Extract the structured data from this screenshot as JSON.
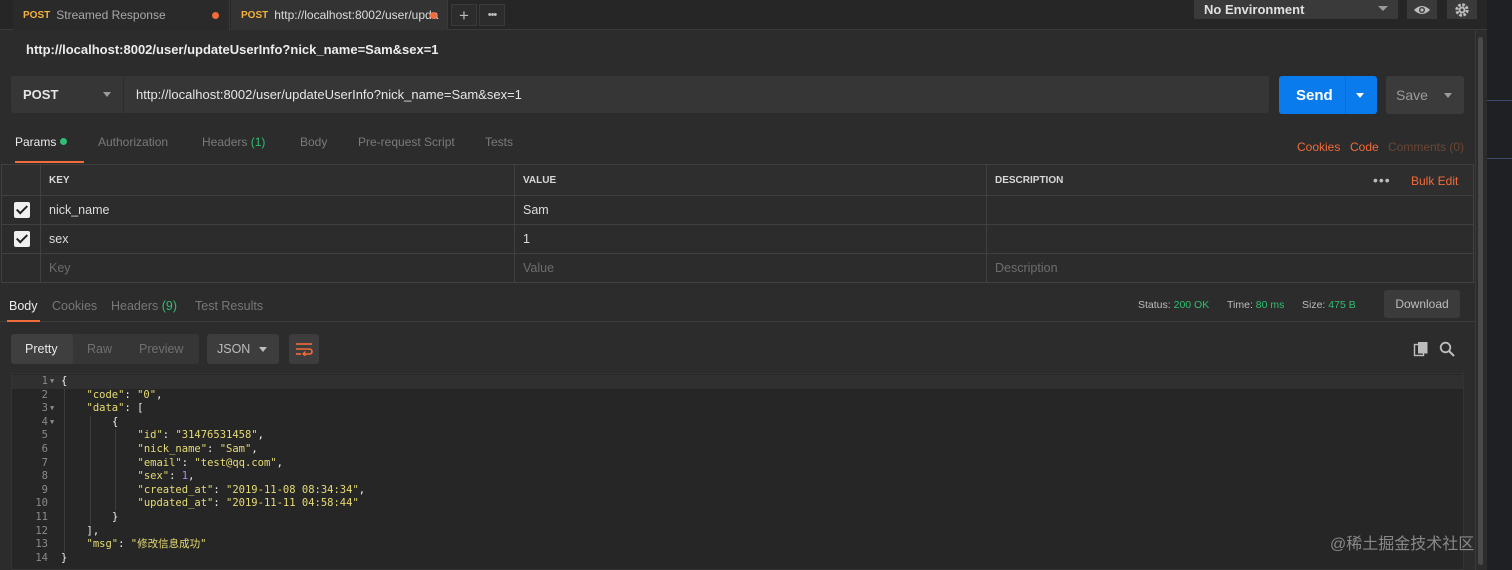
{
  "tabs": [
    {
      "method": "POST",
      "title": "Streamed Response"
    },
    {
      "method": "POST",
      "title": "http://localhost:8002/user/upda"
    }
  ],
  "tab_actions": {
    "add": "+",
    "more": "•••"
  },
  "environment": {
    "selected": "No Environment"
  },
  "request": {
    "name": "http://localhost:8002/user/updateUserInfo?nick_name=Sam&sex=1",
    "method": "POST",
    "url": "http://localhost:8002/user/updateUserInfo?nick_name=Sam&sex=1",
    "send_label": "Send",
    "save_label": "Save"
  },
  "request_tabs": {
    "params": "Params",
    "authorization": "Authorization",
    "headers": "Headers",
    "headers_count": "(1)",
    "body": "Body",
    "prerequest": "Pre-request Script",
    "tests": "Tests",
    "cookies": "Cookies",
    "code": "Code",
    "comments": "Comments (0)"
  },
  "params": {
    "columns": {
      "key": "KEY",
      "value": "VALUE",
      "description": "DESCRIPTION"
    },
    "bulk_edit": "Bulk Edit",
    "rows": [
      {
        "key": "nick_name",
        "value": "Sam",
        "description": ""
      },
      {
        "key": "sex",
        "value": "1",
        "description": ""
      }
    ],
    "placeholders": {
      "key": "Key",
      "value": "Value",
      "description": "Description"
    }
  },
  "response_tabs": {
    "body": "Body",
    "cookies": "Cookies",
    "headers": "Headers",
    "headers_count": "(9)",
    "test_results": "Test Results"
  },
  "response_status": {
    "status_label": "Status:",
    "status_value": "200 OK",
    "time_label": "Time:",
    "time_value": "80 ms",
    "size_label": "Size:",
    "size_value": "475 B",
    "download": "Download"
  },
  "response_view": {
    "pretty": "Pretty",
    "raw": "Raw",
    "preview": "Preview",
    "format": "JSON"
  },
  "response_body": [
    {
      "ln": "1",
      "fold": true,
      "indent": 0,
      "parts": [
        [
          "punc",
          "{"
        ]
      ]
    },
    {
      "ln": "2",
      "fold": false,
      "indent": 1,
      "parts": [
        [
          "key",
          "\"code\""
        ],
        [
          "punc",
          ": "
        ],
        [
          "str",
          "\"0\""
        ],
        [
          "punc",
          ","
        ]
      ]
    },
    {
      "ln": "3",
      "fold": true,
      "indent": 1,
      "parts": [
        [
          "key",
          "\"data\""
        ],
        [
          "punc",
          ": ["
        ]
      ]
    },
    {
      "ln": "4",
      "fold": true,
      "indent": 2,
      "parts": [
        [
          "punc",
          "{"
        ]
      ]
    },
    {
      "ln": "5",
      "fold": false,
      "indent": 3,
      "parts": [
        [
          "key",
          "\"id\""
        ],
        [
          "punc",
          ": "
        ],
        [
          "str",
          "\"31476531458\""
        ],
        [
          "punc",
          ","
        ]
      ]
    },
    {
      "ln": "6",
      "fold": false,
      "indent": 3,
      "parts": [
        [
          "key",
          "\"nick_name\""
        ],
        [
          "punc",
          ": "
        ],
        [
          "str",
          "\"Sam\""
        ],
        [
          "punc",
          ","
        ]
      ]
    },
    {
      "ln": "7",
      "fold": false,
      "indent": 3,
      "parts": [
        [
          "key",
          "\"email\""
        ],
        [
          "punc",
          ": "
        ],
        [
          "str",
          "\"test@qq.com\""
        ],
        [
          "punc",
          ","
        ]
      ]
    },
    {
      "ln": "8",
      "fold": false,
      "indent": 3,
      "parts": [
        [
          "key",
          "\"sex\""
        ],
        [
          "punc",
          ": "
        ],
        [
          "num",
          "1"
        ],
        [
          "punc",
          ","
        ]
      ]
    },
    {
      "ln": "9",
      "fold": false,
      "indent": 3,
      "parts": [
        [
          "key",
          "\"created_at\""
        ],
        [
          "punc",
          ": "
        ],
        [
          "str",
          "\"2019-11-08 08:34:34\""
        ],
        [
          "punc",
          ","
        ]
      ]
    },
    {
      "ln": "10",
      "fold": false,
      "indent": 3,
      "parts": [
        [
          "key",
          "\"updated_at\""
        ],
        [
          "punc",
          ": "
        ],
        [
          "str",
          "\"2019-11-11 04:58:44\""
        ]
      ]
    },
    {
      "ln": "11",
      "fold": false,
      "indent": 2,
      "parts": [
        [
          "punc",
          "}"
        ]
      ]
    },
    {
      "ln": "12",
      "fold": false,
      "indent": 1,
      "parts": [
        [
          "punc",
          "],"
        ]
      ]
    },
    {
      "ln": "13",
      "fold": false,
      "indent": 1,
      "parts": [
        [
          "key",
          "\"msg\""
        ],
        [
          "punc",
          ": "
        ],
        [
          "str",
          "\"修改信息成功\""
        ]
      ]
    },
    {
      "ln": "14",
      "fold": false,
      "indent": 0,
      "parts": [
        [
          "punc",
          "}"
        ]
      ]
    }
  ],
  "watermark": "@稀土掘金技术社区",
  "colors": {
    "accent": "#f26b3a",
    "send": "#097bed",
    "success": "#2fbf71",
    "method": "#f3b23d"
  }
}
